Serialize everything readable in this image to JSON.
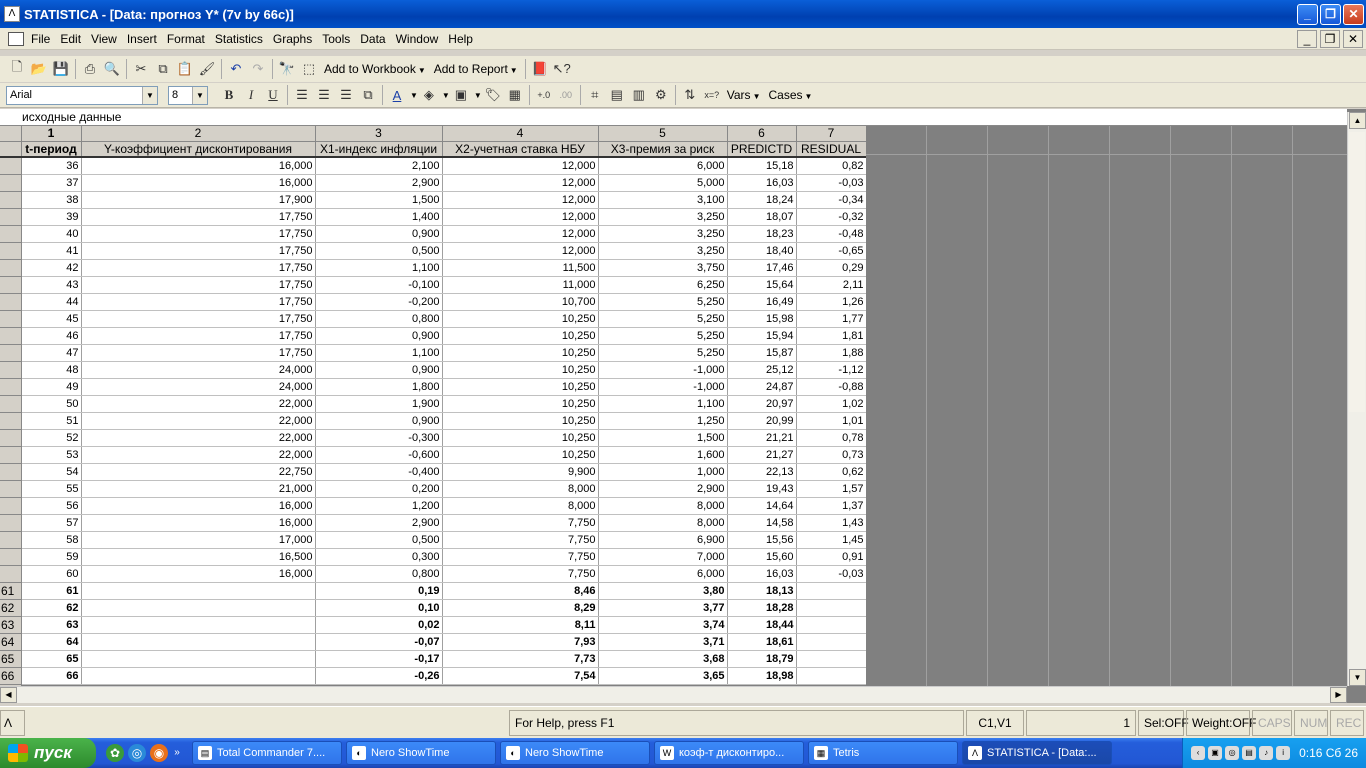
{
  "window": {
    "title": "STATISTICA - [Data: прогноз Y* (7v by 66c)]",
    "app_icon": "statistica-icon"
  },
  "menu": [
    "File",
    "Edit",
    "View",
    "Insert",
    "Format",
    "Statistics",
    "Graphs",
    "Tools",
    "Data",
    "Window",
    "Help"
  ],
  "toolbar1": {
    "add_to_workbook": "Add to Workbook",
    "add_to_report": "Add to Report"
  },
  "toolbar2": {
    "font_name": "Arial",
    "font_size": "8",
    "vars": "Vars",
    "cases": "Cases"
  },
  "sheet": {
    "caption": "исходные данные",
    "col_numbers": [
      "1",
      "2",
      "3",
      "4",
      "5",
      "6",
      "7"
    ],
    "col_names": [
      "t-период",
      "Y-коэффициент дисконтирования",
      "X1-индекс инфляции",
      "X2-учетная ставка НБУ",
      "X3-премия за риск",
      "PREDICTD",
      "RESIDUAL"
    ],
    "rows": [
      {
        "rh": "",
        "c": [
          "36",
          "16,000",
          "2,100",
          "12,000",
          "6,000",
          "15,18",
          "0,82"
        ]
      },
      {
        "rh": "",
        "c": [
          "37",
          "16,000",
          "2,900",
          "12,000",
          "5,000",
          "16,03",
          "-0,03"
        ]
      },
      {
        "rh": "",
        "c": [
          "38",
          "17,900",
          "1,500",
          "12,000",
          "3,100",
          "18,24",
          "-0,34"
        ]
      },
      {
        "rh": "",
        "c": [
          "39",
          "17,750",
          "1,400",
          "12,000",
          "3,250",
          "18,07",
          "-0,32"
        ]
      },
      {
        "rh": "",
        "c": [
          "40",
          "17,750",
          "0,900",
          "12,000",
          "3,250",
          "18,23",
          "-0,48"
        ]
      },
      {
        "rh": "",
        "c": [
          "41",
          "17,750",
          "0,500",
          "12,000",
          "3,250",
          "18,40",
          "-0,65"
        ]
      },
      {
        "rh": "",
        "c": [
          "42",
          "17,750",
          "1,100",
          "11,500",
          "3,750",
          "17,46",
          "0,29"
        ]
      },
      {
        "rh": "",
        "c": [
          "43",
          "17,750",
          "-0,100",
          "11,000",
          "6,250",
          "15,64",
          "2,11"
        ]
      },
      {
        "rh": "",
        "c": [
          "44",
          "17,750",
          "-0,200",
          "10,700",
          "5,250",
          "16,49",
          "1,26"
        ]
      },
      {
        "rh": "",
        "c": [
          "45",
          "17,750",
          "0,800",
          "10,250",
          "5,250",
          "15,98",
          "1,77"
        ]
      },
      {
        "rh": "",
        "c": [
          "46",
          "17,750",
          "0,900",
          "10,250",
          "5,250",
          "15,94",
          "1,81"
        ]
      },
      {
        "rh": "",
        "c": [
          "47",
          "17,750",
          "1,100",
          "10,250",
          "5,250",
          "15,87",
          "1,88"
        ]
      },
      {
        "rh": "",
        "c": [
          "48",
          "24,000",
          "0,900",
          "10,250",
          "-1,000",
          "25,12",
          "-1,12"
        ]
      },
      {
        "rh": "",
        "c": [
          "49",
          "24,000",
          "1,800",
          "10,250",
          "-1,000",
          "24,87",
          "-0,88"
        ]
      },
      {
        "rh": "",
        "c": [
          "50",
          "22,000",
          "1,900",
          "10,250",
          "1,100",
          "20,97",
          "1,02"
        ]
      },
      {
        "rh": "",
        "c": [
          "51",
          "22,000",
          "0,900",
          "10,250",
          "1,250",
          "20,99",
          "1,01"
        ]
      },
      {
        "rh": "",
        "c": [
          "52",
          "22,000",
          "-0,300",
          "10,250",
          "1,500",
          "21,21",
          "0,78"
        ]
      },
      {
        "rh": "",
        "c": [
          "53",
          "22,000",
          "-0,600",
          "10,250",
          "1,600",
          "21,27",
          "0,73"
        ]
      },
      {
        "rh": "",
        "c": [
          "54",
          "22,750",
          "-0,400",
          "9,900",
          "1,000",
          "22,13",
          "0,62"
        ]
      },
      {
        "rh": "",
        "c": [
          "55",
          "21,000",
          "0,200",
          "8,000",
          "2,900",
          "19,43",
          "1,57"
        ]
      },
      {
        "rh": "",
        "c": [
          "56",
          "16,000",
          "1,200",
          "8,000",
          "8,000",
          "14,64",
          "1,37"
        ]
      },
      {
        "rh": "",
        "c": [
          "57",
          "16,000",
          "2,900",
          "7,750",
          "8,000",
          "14,58",
          "1,43"
        ]
      },
      {
        "rh": "",
        "c": [
          "58",
          "17,000",
          "0,500",
          "7,750",
          "6,900",
          "15,56",
          "1,45"
        ]
      },
      {
        "rh": "",
        "c": [
          "59",
          "16,500",
          "0,300",
          "7,750",
          "7,000",
          "15,60",
          "0,91"
        ]
      },
      {
        "rh": "",
        "c": [
          "60",
          "16,000",
          "0,800",
          "7,750",
          "6,000",
          "16,03",
          "-0,03"
        ]
      },
      {
        "rh": "61",
        "bold": true,
        "c": [
          "61",
          "",
          "0,19",
          "8,46",
          "3,80",
          "18,13",
          ""
        ]
      },
      {
        "rh": "62",
        "bold": true,
        "c": [
          "62",
          "",
          "0,10",
          "8,29",
          "3,77",
          "18,28",
          ""
        ]
      },
      {
        "rh": "63",
        "bold": true,
        "c": [
          "63",
          "",
          "0,02",
          "8,11",
          "3,74",
          "18,44",
          ""
        ]
      },
      {
        "rh": "64",
        "bold": true,
        "c": [
          "64",
          "",
          "-0,07",
          "7,93",
          "3,71",
          "18,61",
          ""
        ]
      },
      {
        "rh": "65",
        "bold": true,
        "c": [
          "65",
          "",
          "-0,17",
          "7,73",
          "3,68",
          "18,79",
          ""
        ]
      },
      {
        "rh": "66",
        "bold": true,
        "c": [
          "66",
          "",
          "-0,26",
          "7,54",
          "3,65",
          "18,98",
          ""
        ]
      }
    ]
  },
  "status": {
    "help": "For Help, press F1",
    "cell": "C1,V1",
    "value": "1",
    "sel": "Sel:OFF",
    "weight": "Weight:OFF",
    "caps": "CAPS",
    "num": "NUM",
    "rec": "REC"
  },
  "taskbar": {
    "start": "пуск",
    "tasks": [
      {
        "label": "Total Commander 7....",
        "icon": "total-commander-icon"
      },
      {
        "label": "Nero ShowTime",
        "icon": "nero-icon"
      },
      {
        "label": "Nero ShowTime",
        "icon": "nero-icon"
      },
      {
        "label": "коэф-т дисконтиро...",
        "icon": "word-icon"
      },
      {
        "label": "Tetris",
        "icon": "tetris-icon"
      },
      {
        "label": "STATISTICA - [Data:...",
        "icon": "statistica-icon",
        "active": true
      }
    ],
    "clock": "0:16 Сб 26"
  }
}
